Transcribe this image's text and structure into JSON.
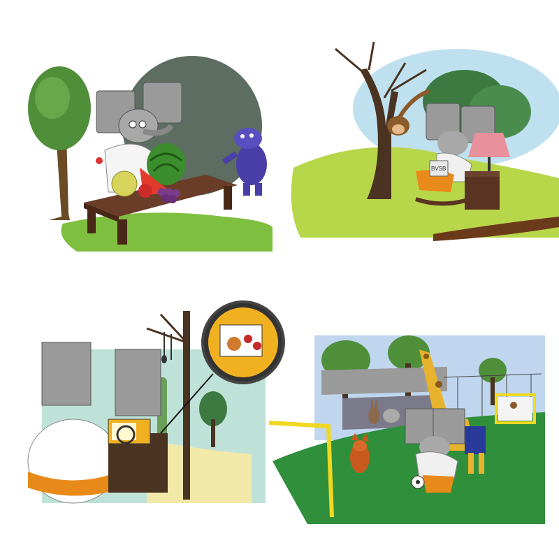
{
  "title": "",
  "panels": [
    {
      "id": "fruit-table"
    },
    {
      "id": "rocking-chair-under-tree"
    },
    {
      "id": "microwave-kitchen"
    },
    {
      "id": "football-field"
    }
  ],
  "shirt_badge_text": "BVSB",
  "colors": {
    "elephant_gray": "#9a9a9a",
    "grass_green": "#7fbf3f",
    "tree_green": "#4f8f3a",
    "wood_brown": "#5a3422",
    "sky_blue": "#bfe0ee",
    "hippo_purple": "#4a3fa8",
    "goal_yellow": "#f0d820",
    "giraffe_yellow": "#e7b22e",
    "orange_belt": "#e88a1a"
  },
  "icons": [
    "tree-icon",
    "watermelon-icon",
    "apple-icon",
    "grapes-icon",
    "hippo-icon",
    "monkey-icon",
    "lamp-icon",
    "microwave-icon",
    "magnifier-icon",
    "giraffe-icon",
    "fox-icon",
    "ball-icon",
    "goal-icon"
  ]
}
